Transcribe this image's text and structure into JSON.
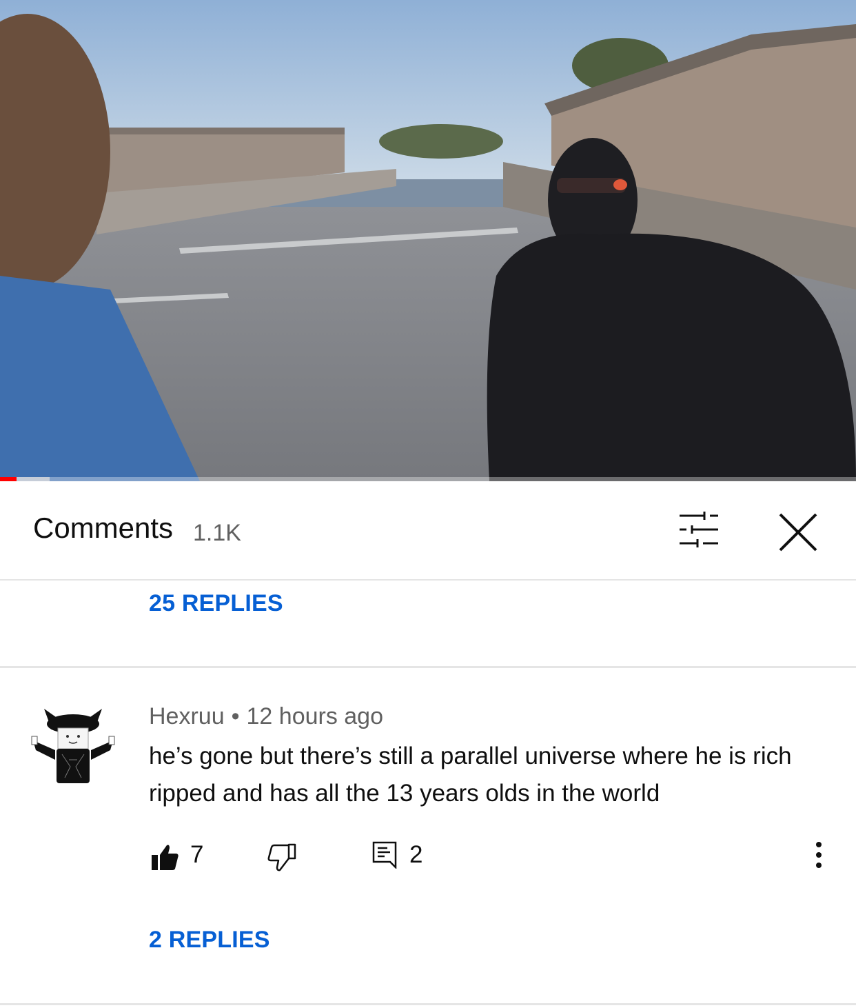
{
  "video": {
    "progress_played_fraction": 0.019,
    "progress_buffered_fraction": 0.058
  },
  "comments_header": {
    "title": "Comments",
    "count": "1.1K",
    "filter_icon": "sort-filter-icon",
    "close_icon": "close-icon"
  },
  "previous_thread": {
    "replies_label": "25 REPLIES"
  },
  "comment": {
    "author": "Hexruu",
    "separator": "•",
    "time": "12 hours ago",
    "text": "he’s gone but there’s still a parallel universe where he is rich ripped and has all the 13 years olds in the world",
    "likes": "7",
    "reply_count": "2",
    "replies_label": "2 REPLIES",
    "icons": [
      "thumbs-up-icon",
      "thumbs-down-icon",
      "reply-icon",
      "more-vert-icon"
    ]
  },
  "colors": {
    "link_blue": "#065fd4",
    "secondary_text": "#606060",
    "progress_red": "#ff0000",
    "divider": "#e5e5e5"
  }
}
